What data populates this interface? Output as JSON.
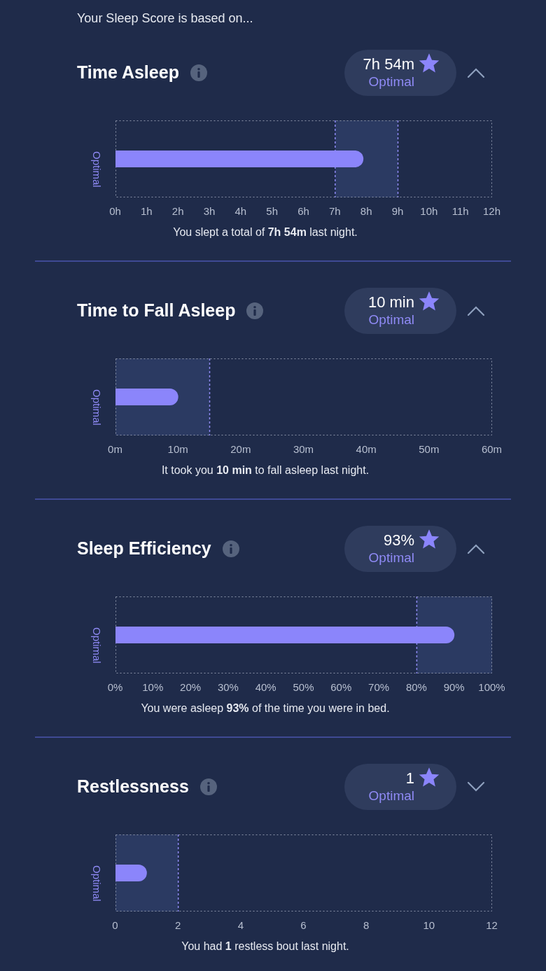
{
  "intro": "Your Sleep Score is based on...",
  "sections": [
    {
      "title": "Time Asleep",
      "score": {
        "value": "7h 54m",
        "rating": "Optimal"
      },
      "expanded": true,
      "caption": "You slept a total of **7h 54m** last night.",
      "chart_data": {
        "type": "bar",
        "orientation": "horizontal",
        "ylabel": "Optimal",
        "values": [
          7.9
        ],
        "xlim": [
          0,
          12
        ],
        "xticks": [
          {
            "value": 0,
            "label": "0h"
          },
          {
            "value": 1,
            "label": "1h"
          },
          {
            "value": 2,
            "label": "2h"
          },
          {
            "value": 3,
            "label": "3h"
          },
          {
            "value": 4,
            "label": "4h"
          },
          {
            "value": 5,
            "label": "5h"
          },
          {
            "value": 6,
            "label": "6h"
          },
          {
            "value": 7,
            "label": "7h"
          },
          {
            "value": 8,
            "label": "8h"
          },
          {
            "value": 9,
            "label": "9h"
          },
          {
            "value": 10,
            "label": "10h"
          },
          {
            "value": 11,
            "label": "11h"
          },
          {
            "value": 12,
            "label": "12h"
          }
        ],
        "bands": [
          {
            "axis": "x",
            "from": 7,
            "to": 9
          }
        ],
        "ref_lines": [
          {
            "axis": "x",
            "value": 7
          },
          {
            "axis": "x",
            "value": 9
          }
        ]
      }
    },
    {
      "title": "Time to Fall Asleep",
      "score": {
        "value": "10 min",
        "rating": "Optimal"
      },
      "expanded": true,
      "caption": "It took you **10 min** to fall asleep last night.",
      "chart_data": {
        "type": "bar",
        "orientation": "horizontal",
        "ylabel": "Optimal",
        "values": [
          10
        ],
        "xlim": [
          0,
          60
        ],
        "xticks": [
          {
            "value": 0,
            "label": "0m"
          },
          {
            "value": 10,
            "label": "10m"
          },
          {
            "value": 20,
            "label": "20m"
          },
          {
            "value": 30,
            "label": "30m"
          },
          {
            "value": 40,
            "label": "40m"
          },
          {
            "value": 50,
            "label": "50m"
          },
          {
            "value": 60,
            "label": "60m"
          }
        ],
        "bands": [
          {
            "axis": "x",
            "from": 0,
            "to": 15
          }
        ],
        "ref_lines": [
          {
            "axis": "x",
            "value": 15
          }
        ]
      }
    },
    {
      "title": "Sleep Efficiency",
      "score": {
        "value": "93%",
        "rating": "Optimal"
      },
      "expanded": true,
      "caption": "You were asleep **93%** of the time you were in bed.",
      "chart_data": {
        "type": "bar",
        "orientation": "horizontal",
        "ylabel": "Optimal",
        "values": [
          90
        ],
        "xlim": [
          0,
          100
        ],
        "xticks": [
          {
            "value": 0,
            "label": "0%"
          },
          {
            "value": 10,
            "label": "10%"
          },
          {
            "value": 20,
            "label": "20%"
          },
          {
            "value": 30,
            "label": "30%"
          },
          {
            "value": 40,
            "label": "40%"
          },
          {
            "value": 50,
            "label": "50%"
          },
          {
            "value": 60,
            "label": "60%"
          },
          {
            "value": 70,
            "label": "70%"
          },
          {
            "value": 80,
            "label": "80%"
          },
          {
            "value": 90,
            "label": "90%"
          },
          {
            "value": 100,
            "label": "100%"
          }
        ],
        "bands": [
          {
            "axis": "x",
            "from": 80,
            "to": 100
          }
        ],
        "ref_lines": [
          {
            "axis": "x",
            "value": 80
          }
        ]
      }
    },
    {
      "title": "Restlessness",
      "score": {
        "value": "1",
        "rating": "Optimal"
      },
      "expanded": false,
      "caption": "You had **1** restless bout last night.",
      "chart_data": {
        "type": "bar",
        "orientation": "horizontal",
        "ylabel": "Optimal",
        "values": [
          1
        ],
        "xlim": [
          0,
          12
        ],
        "xticks": [
          {
            "value": 0,
            "label": "0"
          },
          {
            "value": 2,
            "label": "2"
          },
          {
            "value": 4,
            "label": "4"
          },
          {
            "value": 6,
            "label": "6"
          },
          {
            "value": 8,
            "label": "8"
          },
          {
            "value": 10,
            "label": "10"
          },
          {
            "value": 12,
            "label": "12"
          }
        ],
        "bands": [
          {
            "axis": "x",
            "from": 0,
            "to": 2
          }
        ],
        "ref_lines": [
          {
            "axis": "x",
            "value": 2
          }
        ]
      }
    }
  ]
}
